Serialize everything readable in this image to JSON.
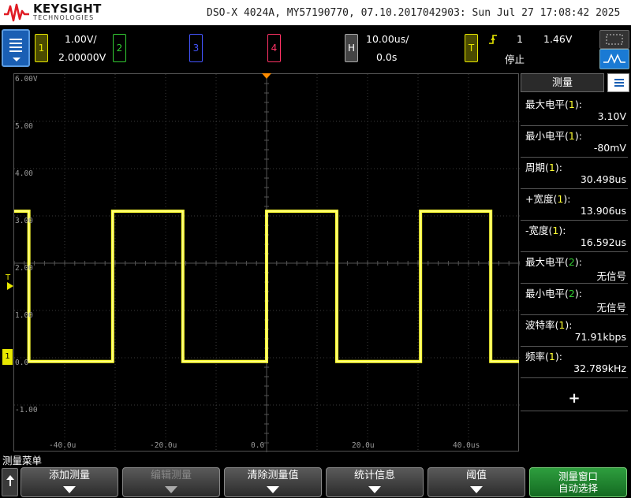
{
  "header": {
    "brand": "KEYSIGHT",
    "brand_sub": "TECHNOLOGIES",
    "status": "DSO-X 4024A, MY57190770, 07.10.2017042903: Sun Jul 27 17:08:42 2025"
  },
  "channels": [
    {
      "num": "1",
      "scale": "1.00V/",
      "offset": "2.00000V",
      "color": "#e8e800"
    },
    {
      "num": "2",
      "color": "#33cc33"
    },
    {
      "num": "3",
      "color": "#4455ff"
    },
    {
      "num": "4",
      "color": "#ff3366"
    }
  ],
  "horizontal": {
    "label": "H",
    "scale": "10.00us/",
    "delay": "0.0s"
  },
  "trigger": {
    "label": "T",
    "source": "1",
    "level": "1.46V",
    "mode": "停止"
  },
  "scope": {
    "y_labels": [
      "6.00V",
      "5.00",
      "4.00",
      "3.00",
      "2.00",
      "1.00",
      "0.0",
      "-1.00"
    ],
    "x_labels": [
      "-40.0u",
      "-20.0u",
      "0.0",
      "20.0u",
      "40.0us"
    ],
    "trace_color": "#ffff33",
    "signal": {
      "high_v": 3.1,
      "low_v": -0.08,
      "period_us": 30.498,
      "pos_width_us": 13.906
    },
    "trigger_marker": "T",
    "ground_marker": "1"
  },
  "measure_panel": {
    "title": "测量",
    "add": "+",
    "rows": [
      {
        "label": "最大电平",
        "ch": "1",
        "value": "3.10V"
      },
      {
        "label": "最小电平",
        "ch": "1",
        "value": "-80mV"
      },
      {
        "label": "周期",
        "ch": "1",
        "value": "30.498us"
      },
      {
        "label": "+宽度",
        "ch": "1",
        "value": "13.906us"
      },
      {
        "label": "-宽度",
        "ch": "1",
        "value": "16.592us"
      },
      {
        "label": "最大电平",
        "ch": "2",
        "value": "无信号"
      },
      {
        "label": "最小电平",
        "ch": "2",
        "value": "无信号"
      },
      {
        "label": "波特率",
        "ch": "1",
        "value": "71.91kbps"
      },
      {
        "label": "频率",
        "ch": "1",
        "value": "32.789kHz"
      }
    ]
  },
  "menu": {
    "title": "测量菜单",
    "softkeys": [
      {
        "label": "添加测量"
      },
      {
        "label": "编辑测量"
      },
      {
        "label": "清除测量值"
      },
      {
        "label": "统计信息"
      },
      {
        "label": "阈值"
      },
      {
        "label": "测量窗口",
        "sub": "自动选择"
      }
    ]
  }
}
